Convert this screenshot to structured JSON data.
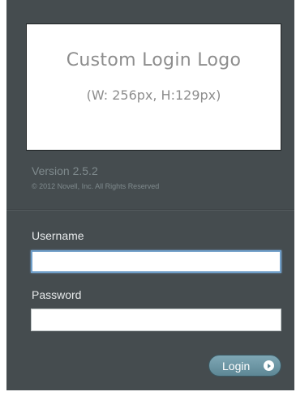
{
  "logo": {
    "title": "Custom Login Logo",
    "subtitle": "(W: 256px, H:129px)"
  },
  "version_text": "Version 2.5.2",
  "copyright_text": "© 2012 Novell, Inc. All Rights Reserved",
  "form": {
    "username_label": "Username",
    "username_value": "",
    "password_label": "Password",
    "password_value": "",
    "login_label": "Login"
  },
  "colors": {
    "panel_background": "#454c4f",
    "button_accent": "#6f98a6",
    "focus_border": "#6f9ec8"
  },
  "icons": {
    "login_button_icon": "arrow-right-circle-icon"
  }
}
